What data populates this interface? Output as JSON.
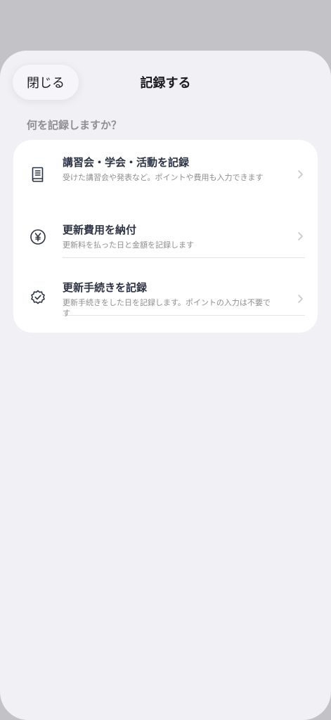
{
  "header": {
    "close_label": "閉じる",
    "title": "記録する"
  },
  "section_label": "何を記録しますか？",
  "items": [
    {
      "label": "講習会・学会・活動を記録",
      "description": "受けた講習会や発表など。ポイントや費用も入力できます",
      "icon": "book-icon"
    },
    {
      "label": "更新費用を納付",
      "description": "更新料を払った日と金額を記録します",
      "icon": "yen-icon"
    },
    {
      "label": "更新手続きを記録",
      "description": "更新手続きをした日を記録します。ポイントの入力は不要です",
      "icon": "verified-badge-icon"
    }
  ],
  "colors": {
    "backdrop": "#c3c2c7",
    "sheet": "#f1f0f5",
    "card": "#ffffff",
    "label_text": "#2c3342",
    "secondary_text": "#8e8e93"
  }
}
